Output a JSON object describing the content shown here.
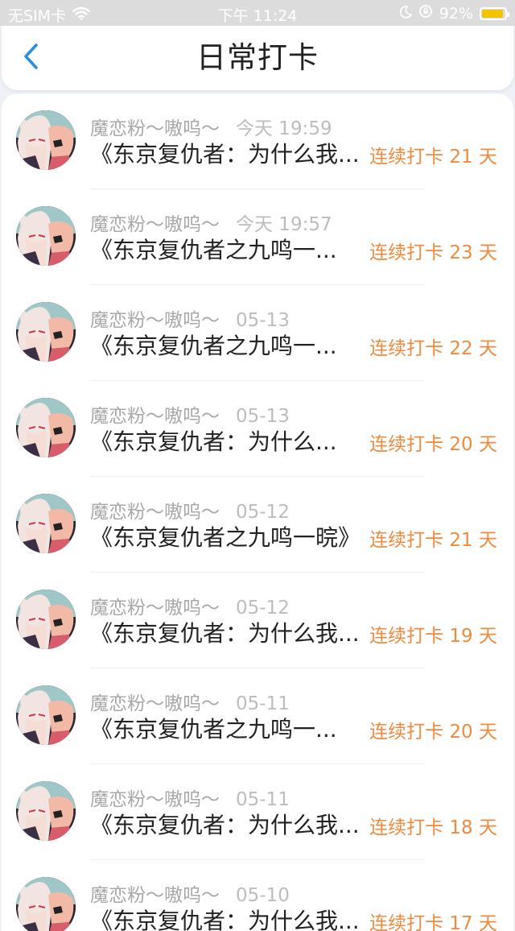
{
  "status_bar": {
    "carrier": "无SIM卡",
    "time": "下午 11:24",
    "battery": "92%",
    "battery_level": 0.92,
    "icons": [
      "wifi-icon",
      "moon-icon",
      "orientation-lock-icon",
      "battery-icon"
    ],
    "colors": {
      "battery_fill": "#f5c400"
    }
  },
  "header": {
    "title": "日常打卡",
    "back_icon": "chevron-left-icon",
    "accent": "#2a8fe0"
  },
  "checkins": [
    {
      "name": "魔恋粉～嗷呜～",
      "time": "今天 19:59",
      "title": "《东京复仇者：为什么我...",
      "streak": "连续打卡 21 天"
    },
    {
      "name": "魔恋粉～嗷呜～",
      "time": "今天 19:57",
      "title": "《东京复仇者之九鸣一...",
      "streak": "连续打卡 23 天"
    },
    {
      "name": "魔恋粉～嗷呜～",
      "time": "05-13",
      "title": "《东京复仇者之九鸣一...",
      "streak": "连续打卡 22 天"
    },
    {
      "name": "魔恋粉～嗷呜～",
      "time": "05-13",
      "title": "《东京复仇者：为什么...",
      "streak": "连续打卡 20 天"
    },
    {
      "name": "魔恋粉～嗷呜～",
      "time": "05-12",
      "title": "《东京复仇者之九鸣一晥》",
      "streak": "连续打卡 21 天"
    },
    {
      "name": "魔恋粉～嗷呜～",
      "time": "05-12",
      "title": "《东京复仇者：为什么我...",
      "streak": "连续打卡 19 天"
    },
    {
      "name": "魔恋粉～嗷呜～",
      "time": "05-11",
      "title": "《东京复仇者之九鸣一...",
      "streak": "连续打卡 20 天"
    },
    {
      "name": "魔恋粉～嗷呜～",
      "time": "05-11",
      "title": "《东京复仇者：为什么我...",
      "streak": "连续打卡 18 天"
    },
    {
      "name": "魔恋粉～嗷呜～",
      "time": "05-10",
      "title": "《东京复仇者：为什么我...",
      "streak": "连续打卡 17 天"
    }
  ],
  "colors": {
    "streak": "#f08a3e",
    "name": "#a8a8a8",
    "title": "#222222"
  }
}
